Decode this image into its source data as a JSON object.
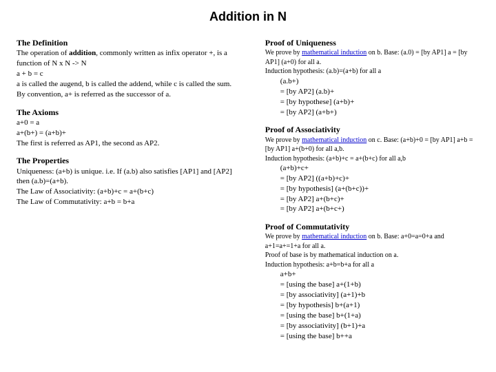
{
  "title": "Addition in N",
  "left": {
    "def_h": "The Definition",
    "def_l1a": "The operation of ",
    "def_l1b": "addition",
    "def_l1c": ", commonly written as infix operator +, is a function of N x N -> N",
    "def_l2": "a + b = c",
    "def_l3": "a is called the augend, b is called the addend, while c is called the sum.",
    "def_l4": "By convention, a+ is referred as the successor of a.",
    "ax_h": "The Axioms",
    "ax_l1": "a+0 = a",
    "ax_l2": "a+(b+) = (a+b)+",
    "ax_l3": "The first is referred as AP1, the second as AP2.",
    "pr_h": "The Properties",
    "pr_l1": "Uniqueness: (a+b) is unique. i.e. If (a.b) also satisfies [AP1] and [AP2]",
    "pr_l2": "then (a.b)=(a+b).",
    "pr_l3": "The Law of Associativity: (a+b)+c = a+(b+c)",
    "pr_l4": "The Law of Commutativity: a+b = b+a"
  },
  "right": {
    "uq_h": "Proof of Uniqueness",
    "uq_pre": "We prove by ",
    "link": "mathematical induction",
    "uq_post": " on b. Base: (a.0) = [by AP1] a = [by AP1] (a+0) for all a.",
    "uq_ih": "Induction hypothesis: (a.b)=(a+b) for all a",
    "uq_r1": "(a.b+)",
    "uq_r2": "= [by AP2] (a.b)+",
    "uq_r3": "= [by hypothese] (a+b)+",
    "uq_r4": "= [by AP2] (a+b+)",
    "as_h": "Proof of Associativity",
    "as_post": " on c. Base: (a+b)+0 = [by AP1] a+b = [by AP1] a+(b+0) for all a,b.",
    "as_ih": "Induction hypothesis: (a+b)+c = a+(b+c) for all a,b",
    "as_r1": "(a+b)+c+",
    "as_r2": "= [by AP2] ((a+b)+c)+",
    "as_r3": "= [by hypothesis] (a+(b+c))+",
    "as_r4": "= [by AP2] a+(b+c)+",
    "as_r5": "= [by AP2] a+(b+c+)",
    "cm_h": "Proof of Commutativity",
    "cm_post": " on b. Base: a+0=a=0+a and a+1=a+=1+a for all a.",
    "cm_pb": "Proof of base is by mathematical induction on a.",
    "cm_ih": "Induction hypothesis: a+b=b+a for all a",
    "cm_r1": "a+b+",
    "cm_r2": "= [using the base] a+(1+b)",
    "cm_r3": "= [by associativity] (a+1)+b",
    "cm_r4": "= [by hypothesis] b+(a+1)",
    "cm_r5": "= [using the base] b+(1+a)",
    "cm_r6": "= [by associativity] (b+1)+a",
    "cm_r7": "= [using the base] b++a"
  }
}
